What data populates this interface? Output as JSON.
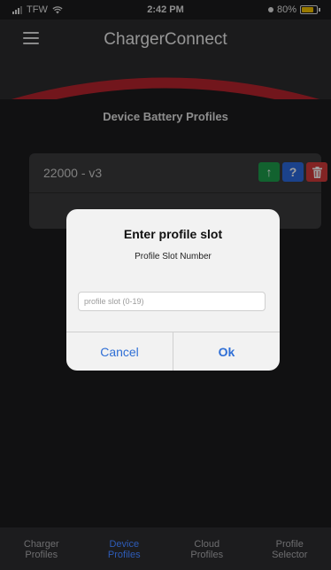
{
  "status_bar": {
    "carrier": "TFW",
    "time": "2:42 PM",
    "battery_percent": "80%"
  },
  "header": {
    "title": "ChargerConnect",
    "menu_icon": "hamburger-menu-icon",
    "accent_color": "#b8242e"
  },
  "main": {
    "section_title": "Device Battery Profiles",
    "profiles": [
      {
        "name": "22000 - v3",
        "actions": [
          {
            "icon": "arrow-up-icon",
            "symbol": "↑",
            "color": "#1e9e4c"
          },
          {
            "icon": "help-icon",
            "symbol": "?",
            "color": "#2d6be0"
          },
          {
            "icon": "trash-icon",
            "symbol": "🗑",
            "color": "#d33a3a"
          }
        ]
      }
    ]
  },
  "dialog": {
    "title": "Enter profile slot",
    "message": "Profile Slot Number",
    "input_placeholder": "profile slot (0-19)",
    "input_value": "",
    "cancel_label": "Cancel",
    "ok_label": "Ok",
    "button_color": "#2f6fd6"
  },
  "tab_bar": {
    "tabs": [
      {
        "line1": "Charger",
        "line2": "Profiles",
        "active": false
      },
      {
        "line1": "Device",
        "line2": "Profiles",
        "active": true
      },
      {
        "line1": "Cloud",
        "line2": "Profiles",
        "active": false
      },
      {
        "line1": "Profile",
        "line2": "Selector",
        "active": false
      }
    ],
    "active_color": "#2e5cb8"
  }
}
